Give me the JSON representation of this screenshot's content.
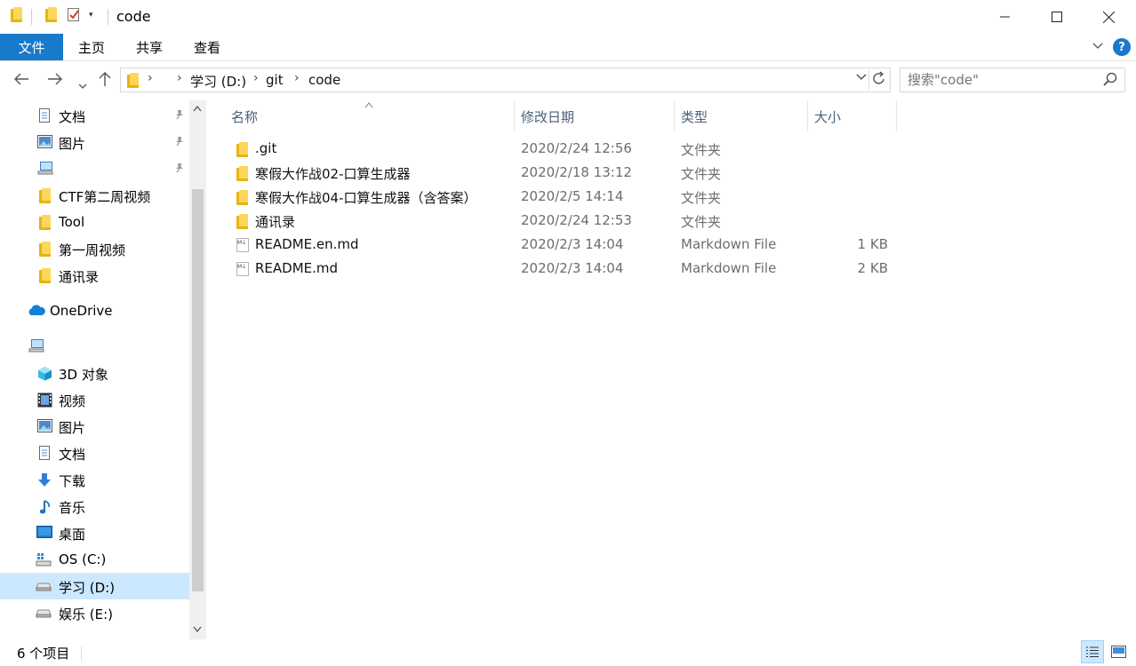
{
  "window": {
    "title": "code",
    "minimize": "—",
    "maximize": "☐",
    "close": "✕"
  },
  "ribbon": {
    "tabs": [
      "文件",
      "主页",
      "共享",
      "查看"
    ],
    "help": "?"
  },
  "address": {
    "crumbs": [
      "学习 (D:)",
      "git",
      "code"
    ]
  },
  "search": {
    "placeholder": "搜索\"code\""
  },
  "sidebar": {
    "items": [
      {
        "label": "文档",
        "icon": "documents-icon",
        "pinned": true
      },
      {
        "label": "图片",
        "icon": "pictures-icon",
        "pinned": true
      },
      {
        "label": "",
        "icon": "computer-icon",
        "pinned": true
      },
      {
        "label": "CTF第二周视频",
        "icon": "folder-icon",
        "pinned": false
      },
      {
        "label": "Tool",
        "icon": "folder-icon",
        "pinned": false
      },
      {
        "label": "第一周视频",
        "icon": "folder-icon",
        "pinned": false
      },
      {
        "label": "通讯录",
        "icon": "folder-icon",
        "pinned": false
      },
      {
        "label": "OneDrive",
        "icon": "onedrive-icon",
        "pinned": false
      },
      {
        "label": "",
        "icon": "this-pc-icon",
        "pinned": false
      },
      {
        "label": "3D 对象",
        "icon": "3d-objects-icon",
        "pinned": false
      },
      {
        "label": "视频",
        "icon": "videos-icon",
        "pinned": false
      },
      {
        "label": "图片",
        "icon": "pictures-icon",
        "pinned": false
      },
      {
        "label": "文档",
        "icon": "documents-icon",
        "pinned": false
      },
      {
        "label": "下载",
        "icon": "downloads-icon",
        "pinned": false
      },
      {
        "label": "音乐",
        "icon": "music-icon",
        "pinned": false
      },
      {
        "label": "桌面",
        "icon": "desktop-icon",
        "pinned": false
      },
      {
        "label": "OS (C:)",
        "icon": "drive-c-icon",
        "pinned": false
      },
      {
        "label": "学习 (D:)",
        "icon": "drive-icon",
        "pinned": false,
        "selected": true
      },
      {
        "label": "娱乐 (E:)",
        "icon": "drive-icon",
        "pinned": false
      }
    ]
  },
  "columns": {
    "name": "名称",
    "date": "修改日期",
    "type": "类型",
    "size": "大小"
  },
  "files": [
    {
      "name": ".git",
      "date": "2020/2/24 12:56",
      "type": "文件夹",
      "size": "",
      "icon": "folder-icon"
    },
    {
      "name": "寒假大作战02-口算生成器",
      "date": "2020/2/18 13:12",
      "type": "文件夹",
      "size": "",
      "icon": "folder-icon"
    },
    {
      "name": "寒假大作战04-口算生成器（含答案）",
      "date": "2020/2/5 14:14",
      "type": "文件夹",
      "size": "",
      "icon": "folder-icon"
    },
    {
      "name": "通讯录",
      "date": "2020/2/24 12:53",
      "type": "文件夹",
      "size": "",
      "icon": "folder-icon"
    },
    {
      "name": "README.en.md",
      "date": "2020/2/3 14:04",
      "type": "Markdown File",
      "size": "1 KB",
      "icon": "markdown-file-icon"
    },
    {
      "name": "README.md",
      "date": "2020/2/3 14:04",
      "type": "Markdown File",
      "size": "2 KB",
      "icon": "markdown-file-icon"
    }
  ],
  "status": {
    "count": "6 个项目"
  },
  "colors": {
    "accent": "#1979ca",
    "selection": "#cce8ff",
    "header_text": "#4c607a"
  }
}
